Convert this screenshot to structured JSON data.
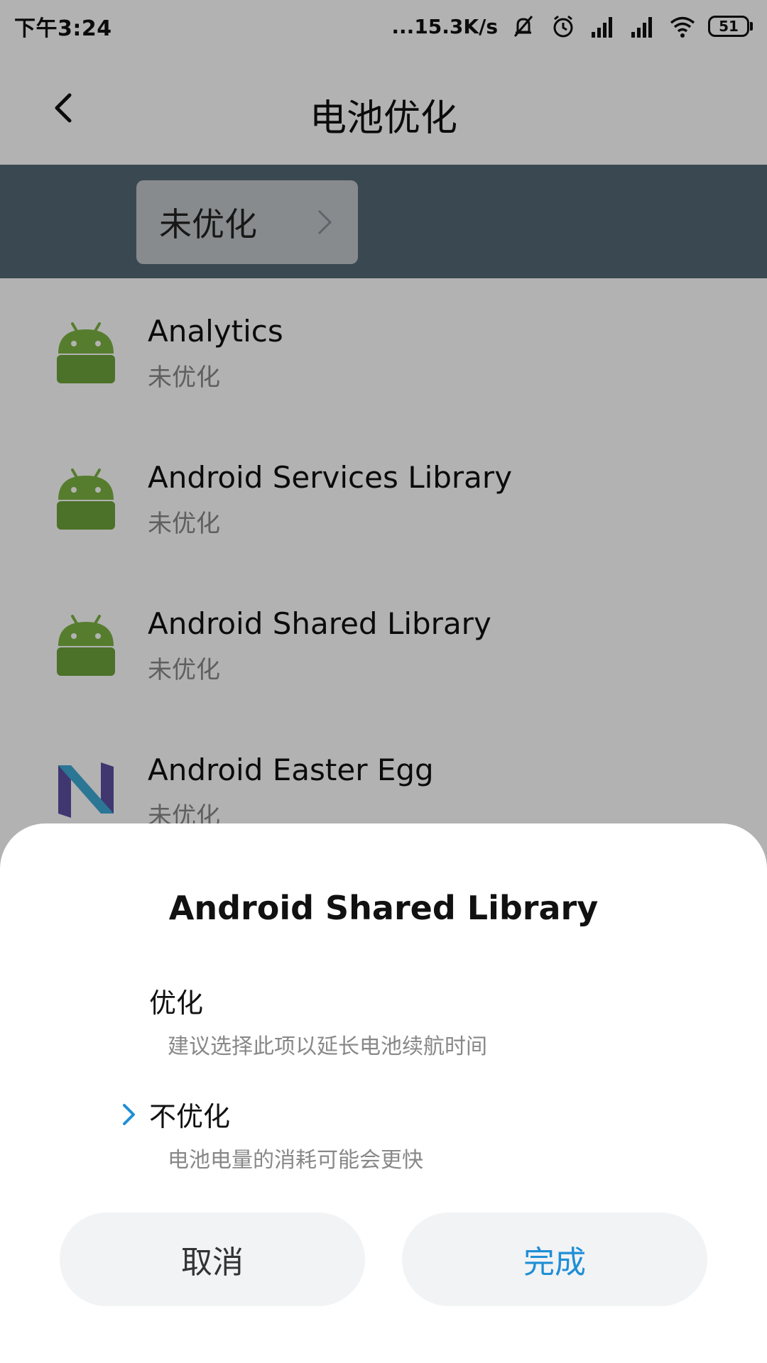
{
  "status_bar": {
    "time": "下午3:24",
    "net_speed": "...15.3K/s",
    "battery_level": "51"
  },
  "header": {
    "title": "电池优化",
    "back_icon": "chevron-left-icon"
  },
  "filter": {
    "label": "未优化",
    "arrow_icon": "chevron-right-icon"
  },
  "apps": [
    {
      "name": "Analytics",
      "status": "未优化",
      "icon": "android-robot-icon"
    },
    {
      "name": "Android Services Library",
      "status": "未优化",
      "icon": "android-robot-icon"
    },
    {
      "name": "Android Shared Library",
      "status": "未优化",
      "icon": "android-robot-icon"
    },
    {
      "name": "Android Easter Egg",
      "status": "未优化",
      "icon": "android-nougat-icon"
    }
  ],
  "dialog": {
    "title": "Android Shared Library",
    "options": [
      {
        "label": "优化",
        "description": "建议选择此项以延长电池续航时间",
        "selected": false
      },
      {
        "label": "不优化",
        "description": "电池电量的消耗可能会更快",
        "selected": true
      }
    ],
    "cancel_label": "取消",
    "done_label": "完成"
  },
  "colors": {
    "accent": "#1f8fd6",
    "android_green": "#7cb342",
    "filter_strip": "#536874"
  }
}
